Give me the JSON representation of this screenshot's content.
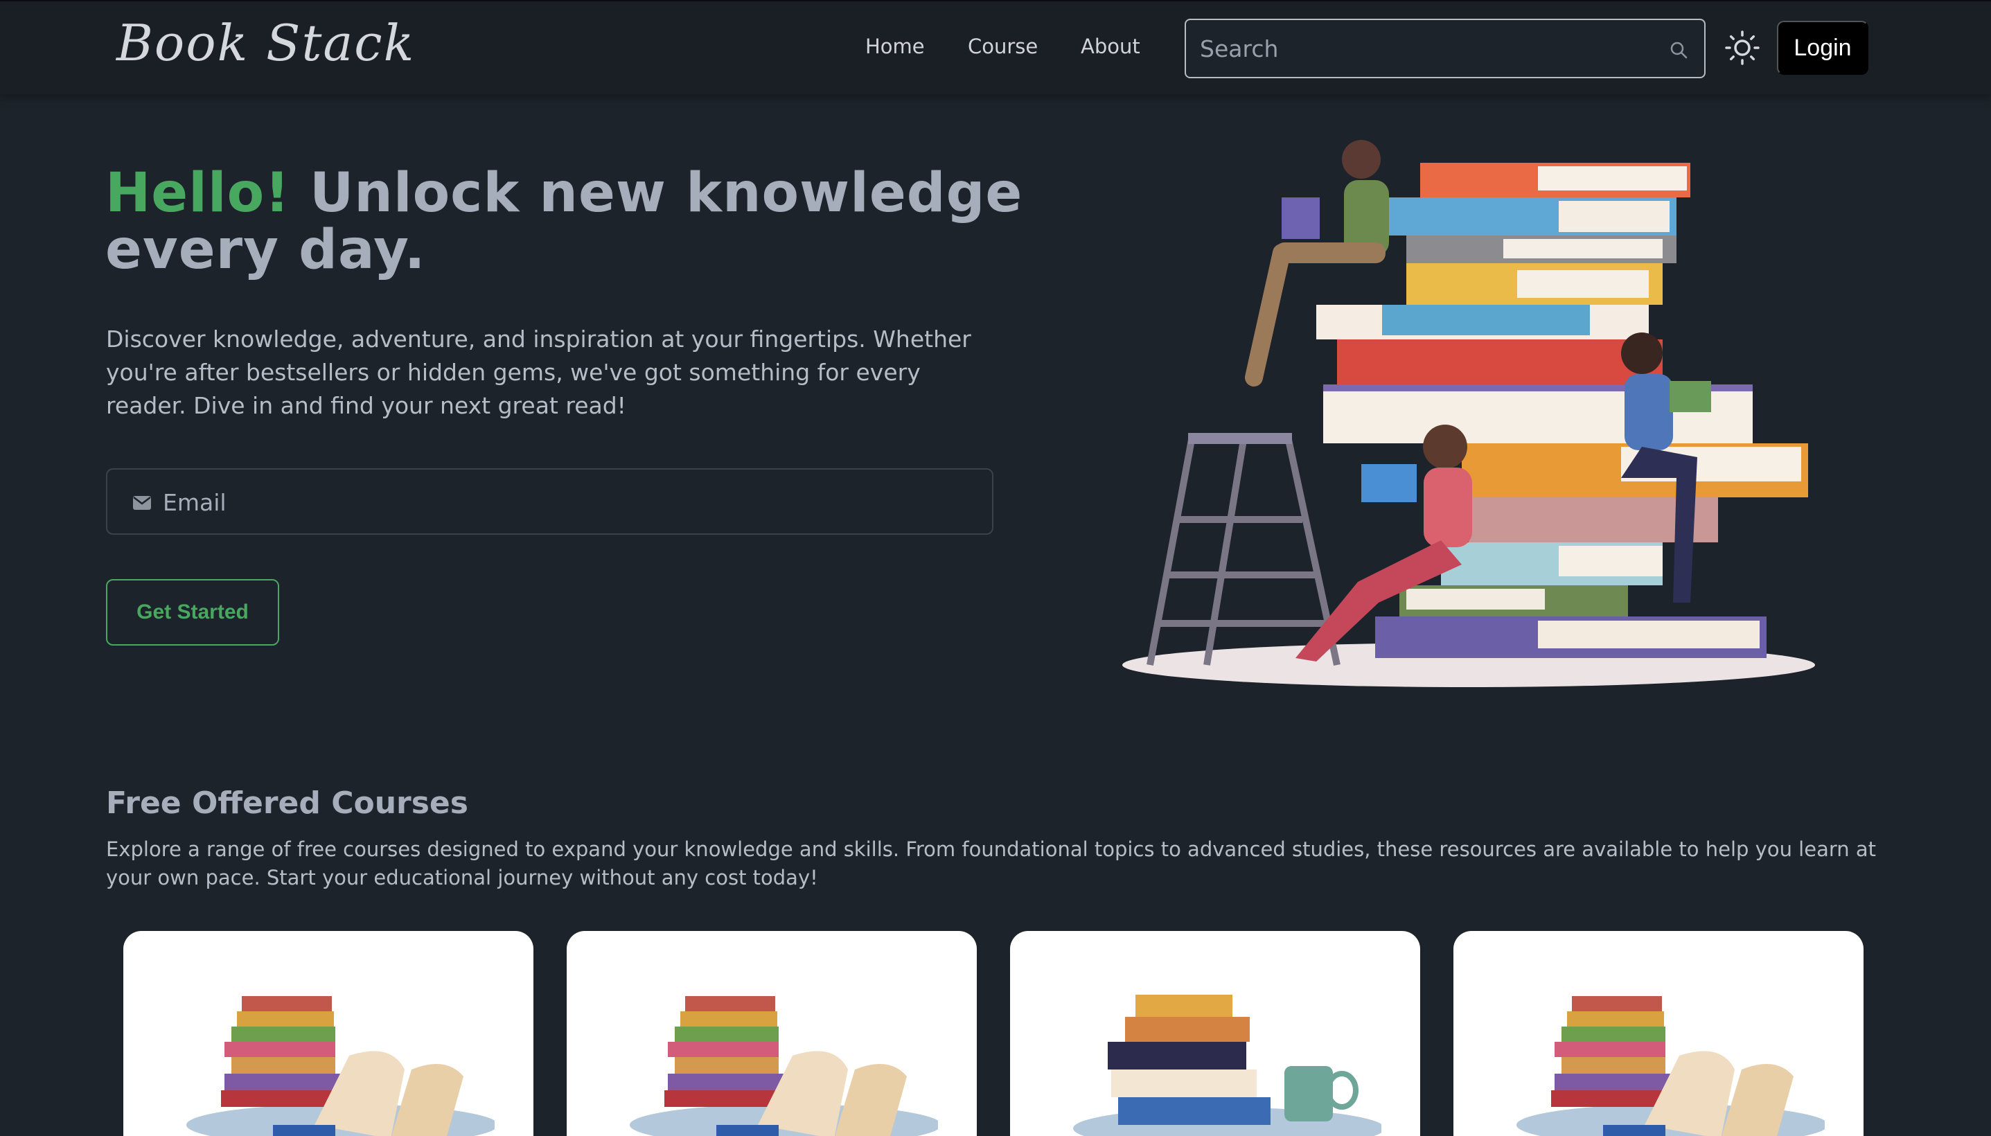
{
  "navbar": {
    "logo": "Book Stack",
    "links": [
      "Home",
      "Course",
      "About"
    ],
    "search_placeholder": "Search",
    "theme_icon": "sun-icon",
    "login_label": "Login"
  },
  "hero": {
    "title_highlight": "Hello!",
    "title_rest": " Unlock new knowledge every day.",
    "description": "Discover knowledge, adventure, and inspiration at your fingertips. Whether you're after bestsellers or hidden gems, we've got something for every reader. Dive in and find your next great read!",
    "email_placeholder": "Email",
    "email_icon": "mail-icon",
    "cta_label": "Get Started"
  },
  "courses": {
    "title": "Free Offered Courses",
    "description": "Explore a range of free courses designed to expand your knowledge and skills. From foundational topics to advanced studies, these resources are available to help you learn at your own pace. Start your educational journey without any cost today!",
    "cards": [
      {
        "image": "book-stack-open-book"
      },
      {
        "image": "book-stack-open-book"
      },
      {
        "image": "book-stack-mug"
      },
      {
        "image": "book-stack-open-book"
      }
    ]
  },
  "colors": {
    "background": "#1d232a",
    "navbar": "#1a1f25",
    "accent_green": "#48a860",
    "text": "#a6adbb",
    "login_bg": "#000000"
  }
}
